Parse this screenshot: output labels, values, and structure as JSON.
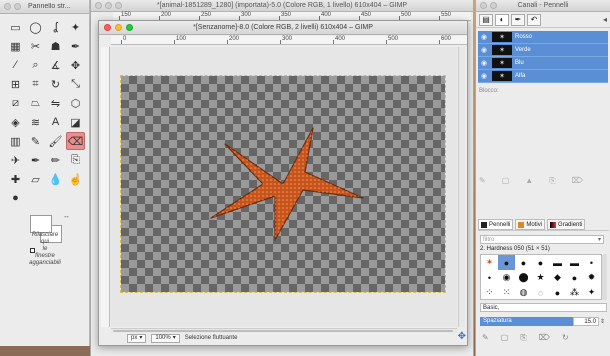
{
  "toolbox": {
    "title": "Pannello str...",
    "tools": [
      {
        "name": "rect-select-icon",
        "glyph": "▭"
      },
      {
        "name": "ellipse-select-icon",
        "glyph": "◯"
      },
      {
        "name": "free-select-icon",
        "glyph": "ʆ"
      },
      {
        "name": "fuzzy-select-icon",
        "glyph": "✦"
      },
      {
        "name": "color-select-icon",
        "glyph": "▦"
      },
      {
        "name": "scissors-icon",
        "glyph": "✂"
      },
      {
        "name": "foreground-select-icon",
        "glyph": "☗"
      },
      {
        "name": "paths-icon",
        "glyph": "✒"
      },
      {
        "name": "color-picker-icon",
        "glyph": "⁄"
      },
      {
        "name": "zoom-icon",
        "glyph": "⌕"
      },
      {
        "name": "measure-icon",
        "glyph": "∡"
      },
      {
        "name": "move-icon",
        "glyph": "✥"
      },
      {
        "name": "align-icon",
        "glyph": "⊞"
      },
      {
        "name": "crop-icon",
        "glyph": "⌗"
      },
      {
        "name": "rotate-icon",
        "glyph": "↻"
      },
      {
        "name": "scale-icon",
        "glyph": "⤡"
      },
      {
        "name": "shear-icon",
        "glyph": "⧄"
      },
      {
        "name": "perspective-icon",
        "glyph": "⏢"
      },
      {
        "name": "flip-icon",
        "glyph": "⇋"
      },
      {
        "name": "cage-icon",
        "glyph": "⬡"
      },
      {
        "name": "unified-transform-icon",
        "glyph": "◈"
      },
      {
        "name": "warp-icon",
        "glyph": "≋"
      },
      {
        "name": "text-icon",
        "glyph": "A"
      },
      {
        "name": "bucket-fill-icon",
        "glyph": "◪"
      },
      {
        "name": "gradient-icon",
        "glyph": "▥"
      },
      {
        "name": "pencil-icon",
        "glyph": "✎"
      },
      {
        "name": "paintbrush-icon",
        "glyph": "🖌"
      },
      {
        "name": "eraser-icon",
        "glyph": "⌫"
      },
      {
        "name": "airbrush-icon",
        "glyph": "✈"
      },
      {
        "name": "ink-icon",
        "glyph": "✒"
      },
      {
        "name": "mypaint-brush-icon",
        "glyph": "✏"
      },
      {
        "name": "clone-icon",
        "glyph": "⎘"
      },
      {
        "name": "heal-icon",
        "glyph": "✚"
      },
      {
        "name": "perspective-clone-icon",
        "glyph": "⏥"
      },
      {
        "name": "blur-icon",
        "glyph": "💧"
      },
      {
        "name": "smudge-icon",
        "glyph": "☝"
      },
      {
        "name": "dodge-burn-icon",
        "glyph": "●"
      }
    ],
    "active_tool_index": 27,
    "drop_hint": [
      "Rilasciare",
      "qui",
      "le",
      "finestre",
      "agganciabili"
    ]
  },
  "back_window": {
    "title": "*[animal-1851289_1280] (importata)-5.0 (Colore RGB, 1 livello) 610x404 – GIMP",
    "ruler_labels": [
      "150",
      "200",
      "250",
      "300",
      "350",
      "400",
      "450",
      "500",
      "550"
    ]
  },
  "image_window": {
    "title": "*[Senzanome]-8.0 (Colore RGB, 2 livelli) 610x404 – GIMP",
    "ruler_labels": [
      "0",
      "100",
      "200",
      "300",
      "400",
      "500",
      "600"
    ],
    "unit": "px",
    "zoom": "100%",
    "status": "Selezione fluttuante",
    "colors": {
      "selection_outline": "#d8c34a",
      "starfish": "#c8541c"
    }
  },
  "dock": {
    "title": "Canali - Pennelli",
    "channels": [
      {
        "name": "Rosso"
      },
      {
        "name": "Verde"
      },
      {
        "name": "Blu"
      },
      {
        "name": "Alfa"
      }
    ],
    "locked_label": "Blocco:",
    "brush_tabs": [
      "Pennelli",
      "Motivi",
      "Gradienti"
    ],
    "tag_placeholder": "filtro",
    "brush_name": "2. Hardness 050 (51 × 51)",
    "preset": "Basic,",
    "spacing_label": "Spaziatura",
    "spacing_value": "15.0",
    "accent": "#5a8fd6"
  }
}
